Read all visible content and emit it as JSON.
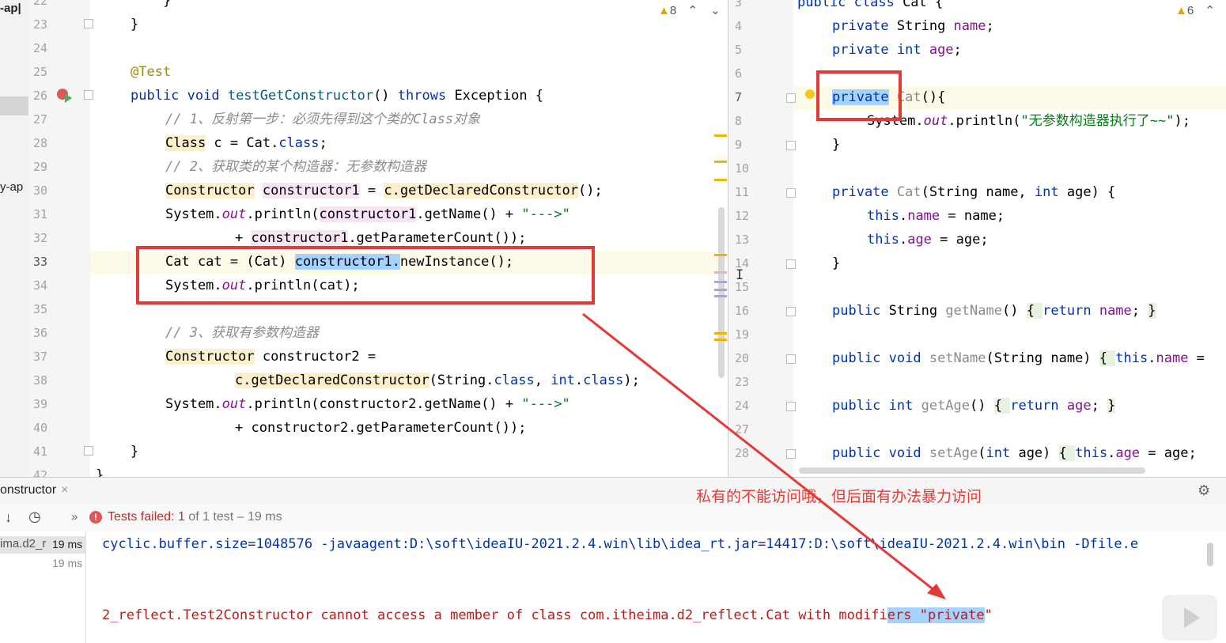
{
  "project_panel": {
    "items": [
      "-ap|",
      "y-ap"
    ]
  },
  "left_editor": {
    "warning_count": "8",
    "lines": [
      {
        "n": "22",
        "code": "    }"
      },
      {
        "n": "23",
        "code": "}"
      },
      {
        "n": "24",
        "code": ""
      },
      {
        "n": "25",
        "code": "@Test"
      },
      {
        "n": "26",
        "code": "public void testGetConstructor() throws Exception {"
      },
      {
        "n": "27",
        "code": "// 1、反射第一步：必须先得到这个类的Class对象"
      },
      {
        "n": "28",
        "code": "Class c = Cat.class;"
      },
      {
        "n": "29",
        "code": "// 2、获取类的某个构造器：无参数构造器"
      },
      {
        "n": "30",
        "code": "Constructor constructor1 = c.getDeclaredConstructor();"
      },
      {
        "n": "31",
        "code": "System.out.println(constructor1.getName() + \"--->\""
      },
      {
        "n": "32",
        "code": "+ constructor1.getParameterCount());"
      },
      {
        "n": "33",
        "code": "Cat cat = (Cat) constructor1.newInstance();"
      },
      {
        "n": "34",
        "code": "System.out.println(cat);"
      },
      {
        "n": "35",
        "code": ""
      },
      {
        "n": "36",
        "code": "// 3、获取有参数构造器"
      },
      {
        "n": "37",
        "code": "Constructor constructor2 ="
      },
      {
        "n": "38",
        "code": "c.getDeclaredConstructor(String.class, int.class);"
      },
      {
        "n": "39",
        "code": "System.out.println(constructor2.getName() + \"--->\""
      },
      {
        "n": "40",
        "code": "+ constructor2.getParameterCount());"
      },
      {
        "n": "41",
        "code": "}"
      },
      {
        "n": "42",
        "code": "}"
      }
    ]
  },
  "right_editor": {
    "warning_count": "6",
    "lines": [
      {
        "n": "3",
        "code": "public class Cat {"
      },
      {
        "n": "4",
        "code": "private String name;"
      },
      {
        "n": "5",
        "code": "private int age;"
      },
      {
        "n": "6",
        "code": ""
      },
      {
        "n": "7",
        "code": "private Cat(){"
      },
      {
        "n": "8",
        "code": "System.out.println(\"无参数构造器执行了~~\");"
      },
      {
        "n": "9",
        "code": "}"
      },
      {
        "n": "10",
        "code": ""
      },
      {
        "n": "11",
        "code": "private Cat(String name, int age) {"
      },
      {
        "n": "12",
        "code": "this.name = name;"
      },
      {
        "n": "13",
        "code": "this.age = age;"
      },
      {
        "n": "14",
        "code": "}"
      },
      {
        "n": "15",
        "code": ""
      },
      {
        "n": "16",
        "code": "public String getName() { return name; }"
      },
      {
        "n": "19",
        "code": ""
      },
      {
        "n": "20",
        "code": "public void setName(String name) { this.name ="
      },
      {
        "n": "23",
        "code": ""
      },
      {
        "n": "24",
        "code": "public int getAge() { return age; }"
      },
      {
        "n": "27",
        "code": ""
      },
      {
        "n": "28",
        "code": "public void setAge(int age) { this.age = age;"
      }
    ]
  },
  "annotation_text": "私有的不能访问哦，但后面有办法暴力访问",
  "run_panel": {
    "tab_label": "onstructor",
    "status_prefix": "Tests failed:",
    "failed_count": "1",
    "status_suffix": "of 1 test – 19 ms",
    "tree": [
      {
        "name": "ima.d2_r",
        "time": "19 ms"
      },
      {
        "name": "",
        "time": "19 ms"
      }
    ],
    "console_line1": "cyclic.buffer.size=1048576 -javaagent:D:\\soft\\ideaIU-2021.2.4.win\\lib\\idea_rt.jar=14417:D:\\soft\\ideaIU-2021.2.4.win\\bin -Dfile.e",
    "console_line3_pre": "2_reflect.Test2Constructor cannot access a member of class com.itheima.d2_reflect.Cat with modifi",
    "console_line3_hl": "ers \"private",
    "console_line3_post": "\""
  },
  "colors": {
    "accent_red": "#e53935",
    "keyword": "#0033b3",
    "error": "#b71c1c"
  }
}
